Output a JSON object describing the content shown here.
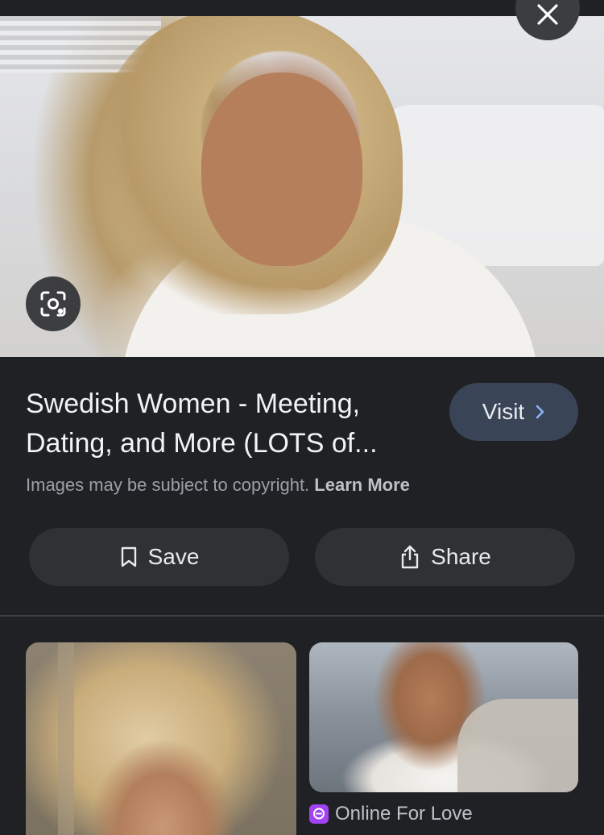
{
  "result": {
    "title_line1": "Swedish Women - Meeting,",
    "title_line2": "Dating, and More (LOTS of...",
    "visit_label": "Visit",
    "copyright_text": "Images may be subject to copyright.",
    "learn_more_label": "Learn More"
  },
  "actions": {
    "save_label": "Save",
    "share_label": "Share"
  },
  "related": [
    {
      "source": ""
    },
    {
      "source": "Online For Love"
    }
  ],
  "icons": {
    "close": "close-icon",
    "lens": "lens-icon",
    "visit": "chevron-right-icon",
    "save": "bookmark-icon",
    "share": "share-icon",
    "source": "site-favicon"
  },
  "colors": {
    "background": "#202124",
    "visit_button": "#394457",
    "action_button": "#303134",
    "favicon": "#a142f4"
  }
}
